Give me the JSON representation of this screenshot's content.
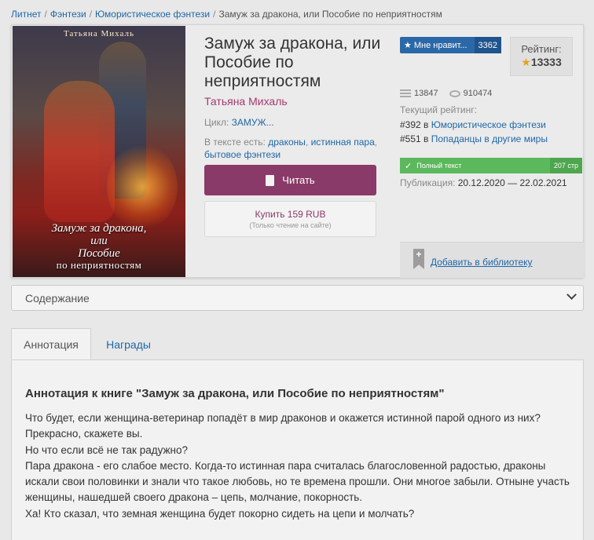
{
  "breadcrumbs": {
    "items": [
      "Литнет",
      "Фэнтези",
      "Юмористическое фэнтези"
    ],
    "current": "Замуж за дракона, или Пособие по неприятностям"
  },
  "cover": {
    "author": "Татьяна Михаль",
    "title_line1": "Замуж за дракона,",
    "title_line2": "или",
    "title_line3": "Пособие",
    "title_line4": "по неприятностям"
  },
  "book": {
    "title": "Замуж за дракона, или Пособие по неприятностям",
    "author": "Татьяна Михаль",
    "cycle_label": "Цикл:",
    "cycle_value": "ЗАМУЖ...",
    "tags_label": "В тексте есть:",
    "tags": [
      "драконы",
      "истинная пара",
      "бытовое фэнтези"
    ]
  },
  "actions": {
    "read_label": "Читать",
    "buy_label": "Купить 159 RUB",
    "buy_note": "(Только чтение на сайте)",
    "add_library": "Добавить в библиотеку"
  },
  "like": {
    "label": "Мне нравит...",
    "count": "3362"
  },
  "rating": {
    "label": "Рейтинг:",
    "value": "13333"
  },
  "stats": {
    "library_count": "13847",
    "views": "910474"
  },
  "current_rating": {
    "label": "Текущий рейтинг:",
    "ranks": [
      {
        "pos": "#392 в",
        "genre": "Юмористическое фэнтези"
      },
      {
        "pos": "#551 в",
        "genre": "Попаданцы в другие миры"
      }
    ]
  },
  "progress": {
    "label": "Полный текст",
    "pages": "207 стр",
    "fraction": 1.0
  },
  "publication": {
    "label": "Публикация:",
    "dates": "20.12.2020 — 22.02.2021"
  },
  "contents_select": {
    "value": "Содержание"
  },
  "tabs": [
    {
      "label": "Аннотация",
      "active": true
    },
    {
      "label": "Награды",
      "active": false
    }
  ],
  "annotation": {
    "title": "Аннотация к книге \"Замуж за дракона, или Пособие по неприятностям\"",
    "paragraphs": [
      "Что будет, если женщина-ветеринар попадёт в мир драконов и окажется истинной парой одного из них?",
      "Прекрасно, скажете вы.",
      "Но что если всё не так радужно?",
      "Пара дракона - его слабое место. Когда-то истинная пара считалась благословенной радостью, драконы искали свои половинки и знали что такое любовь, но те времена прошли. Они многое забыли. Отныне участь женщины, нашедшей своего дракона – цепь, молчание, покорность.",
      "Ха! Кто сказал, что земная женщина будет покорно сидеть на цепи и молчать?"
    ]
  },
  "colors": {
    "accent": "#8a3a68",
    "link": "#1e67a8",
    "like_bg": "#2b68a8",
    "progress_bg": "#5cb85c",
    "star": "#e8a11c"
  }
}
